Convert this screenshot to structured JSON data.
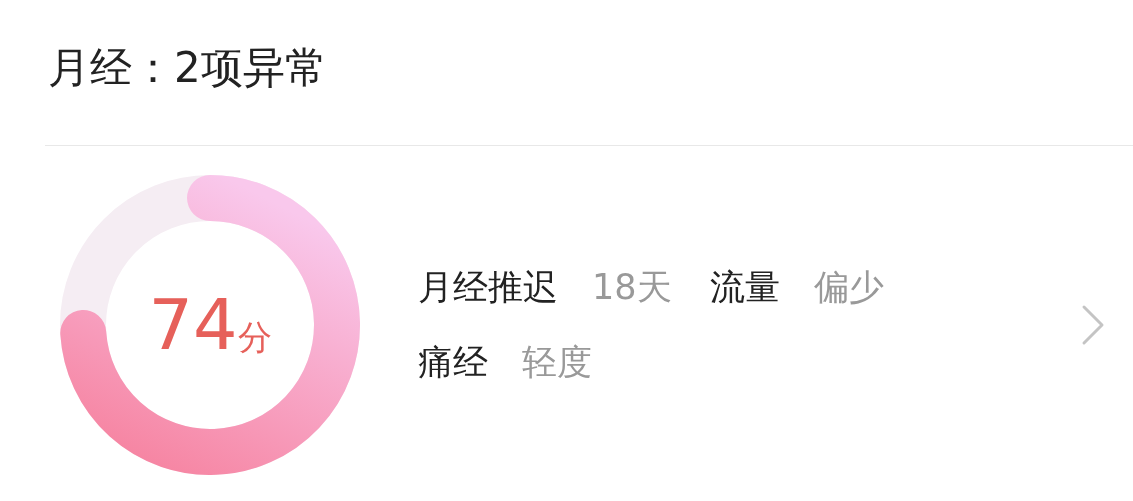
{
  "title": "月经：2项异常",
  "score": {
    "value": "74",
    "unit": "分"
  },
  "rows": [
    [
      {
        "label": "月经推迟",
        "value": "18天"
      },
      {
        "label": "流量",
        "value": "偏少"
      }
    ],
    [
      {
        "label": "痛经",
        "value": "轻度"
      }
    ]
  ]
}
